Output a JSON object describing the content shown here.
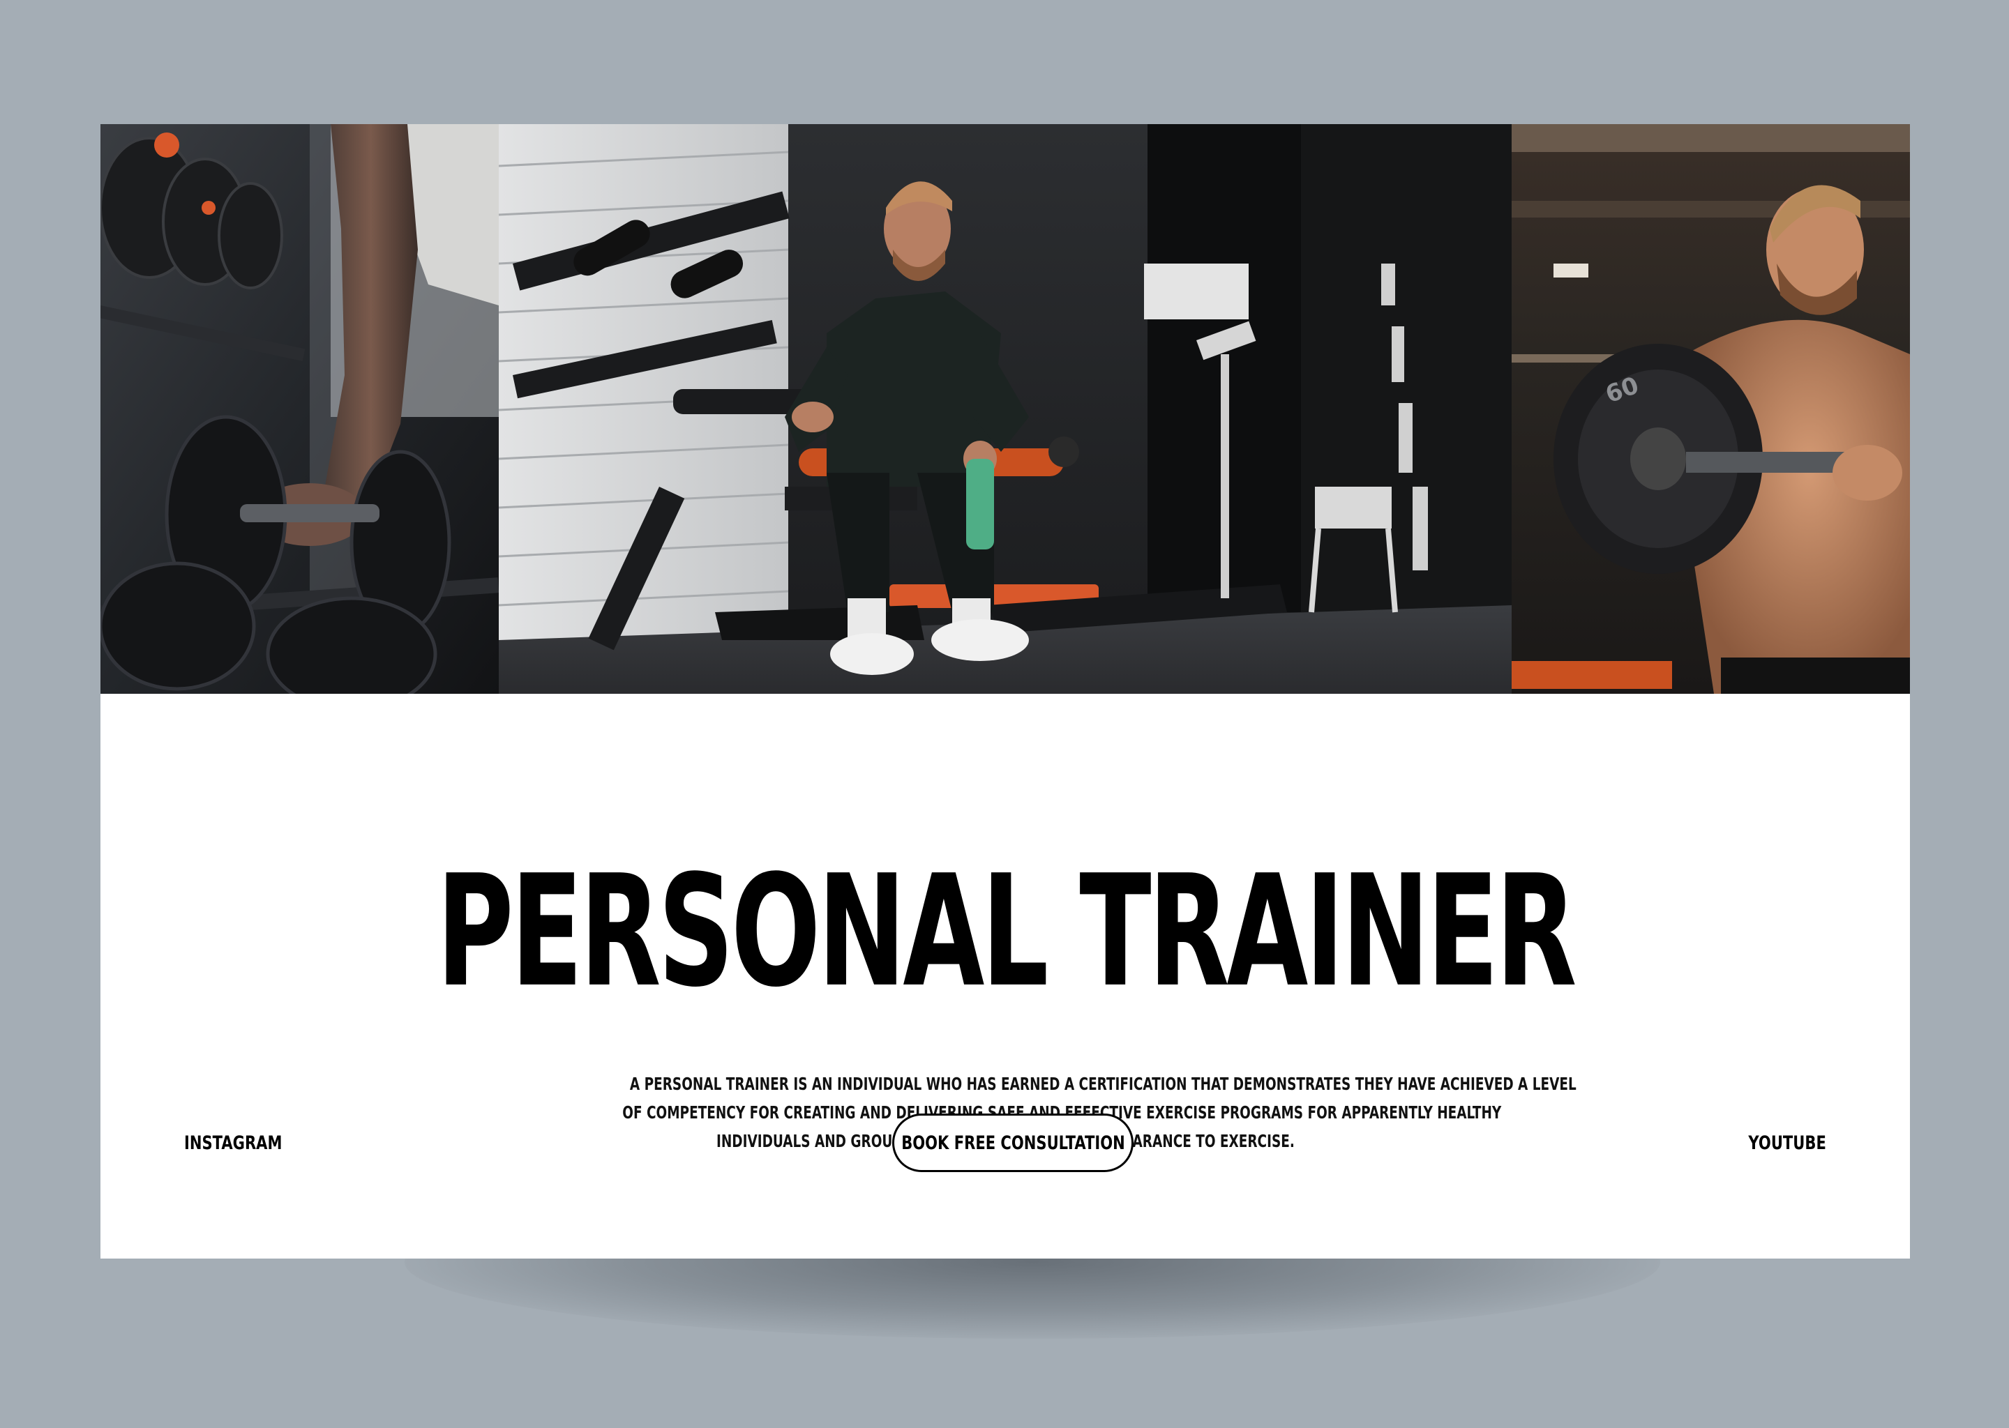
{
  "page": {
    "background_color": "#a4adb5",
    "card_color": "#ffffff",
    "accent_color": "#d9582b"
  },
  "hero": {
    "images": [
      {
        "name": "dumbbell-rack-photo"
      },
      {
        "name": "trainer-seated-on-bench-photo"
      },
      {
        "name": "trainer-lifting-plate-photo"
      }
    ]
  },
  "content": {
    "headline": "PERSONAL TRAINER",
    "description_lines": [
      "A PERSONAL TRAINER IS AN INDIVIDUAL WHO HAS EARNED A CERTIFICATION THAT DEMONSTRATES THEY HAVE ACHIEVED A LEVEL",
      "OF COMPETENCY FOR CREATING AND DELIVERING SAFE AND EFFECTIVE EXERCISE PROGRAMS FOR APPARENTLY HEALTHY",
      "INDIVIDUALS AND GROUPS OR THOSE WITH MEDICAL CLEARANCE TO EXERCISE."
    ]
  },
  "footer": {
    "left_link": "INSTAGRAM",
    "cta_label": "BOOK FREE CONSULTATION",
    "right_link": "YOUTUBE"
  }
}
